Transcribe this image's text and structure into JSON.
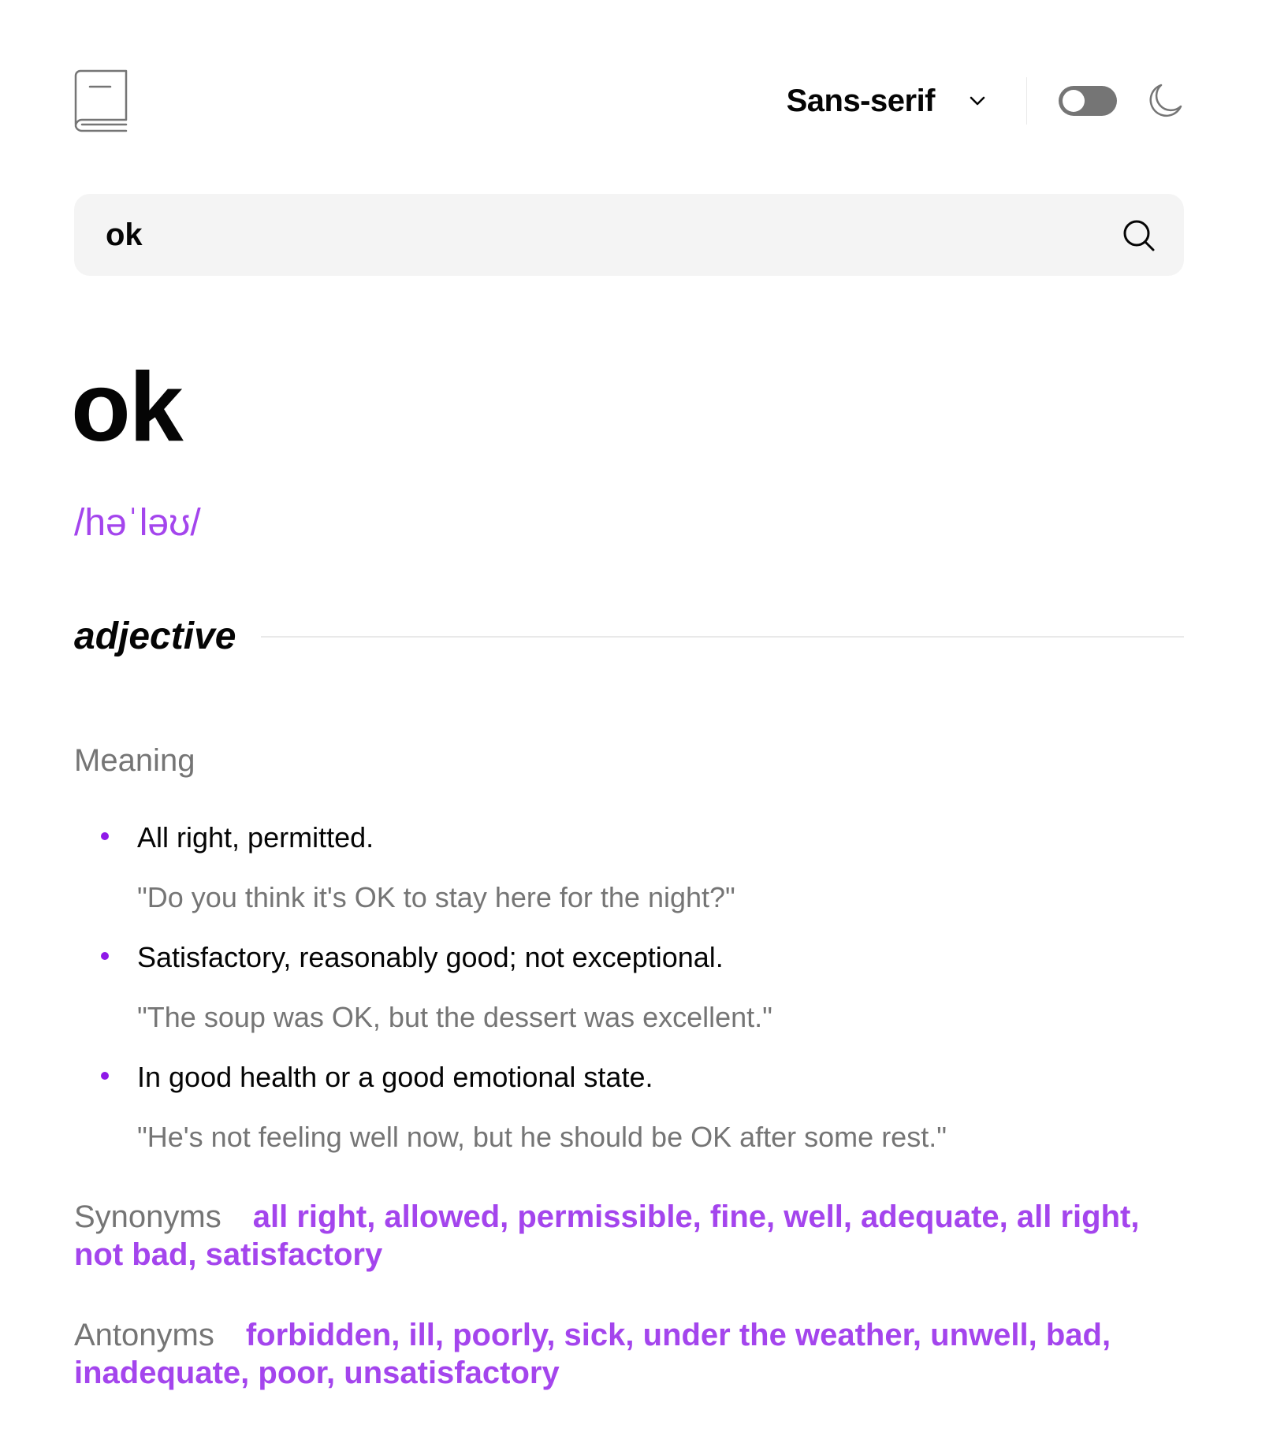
{
  "header": {
    "logo_icon": "book-icon",
    "font_selector": {
      "label": "Sans-serif",
      "icon": "chevron-down-icon"
    },
    "theme_toggle": {
      "state": "off",
      "icon": "moon-icon"
    }
  },
  "search": {
    "value": "ok",
    "icon": "search-icon"
  },
  "entry": {
    "word": "ok",
    "phonetic": "/həˈləʊ/",
    "part_of_speech": "adjective",
    "meaning_label": "Meaning",
    "definitions": [
      {
        "text": "All right, permitted.",
        "example": "\"Do you think it's OK to stay here for the night?\""
      },
      {
        "text": "Satisfactory, reasonably good; not exceptional.",
        "example": "\"The soup was OK, but the dessert was excellent.\""
      },
      {
        "text": "In good health or a good emotional state.",
        "example": "\"He's not feeling well now, but he should be OK after some rest.\""
      }
    ],
    "synonyms_label": "Synonyms",
    "synonyms": "all right, allowed, permissible, fine, well, adequate, all right, not bad, satisfactory",
    "antonyms_label": "Antonyms",
    "antonyms": "forbidden, ill, poorly, sick, under the weather, unwell, bad, inadequate, poor, unsatisfactory"
  },
  "colors": {
    "accent": "#a445ed",
    "muted": "#757575",
    "search_bg": "#f4f4f4",
    "text": "#050505"
  }
}
